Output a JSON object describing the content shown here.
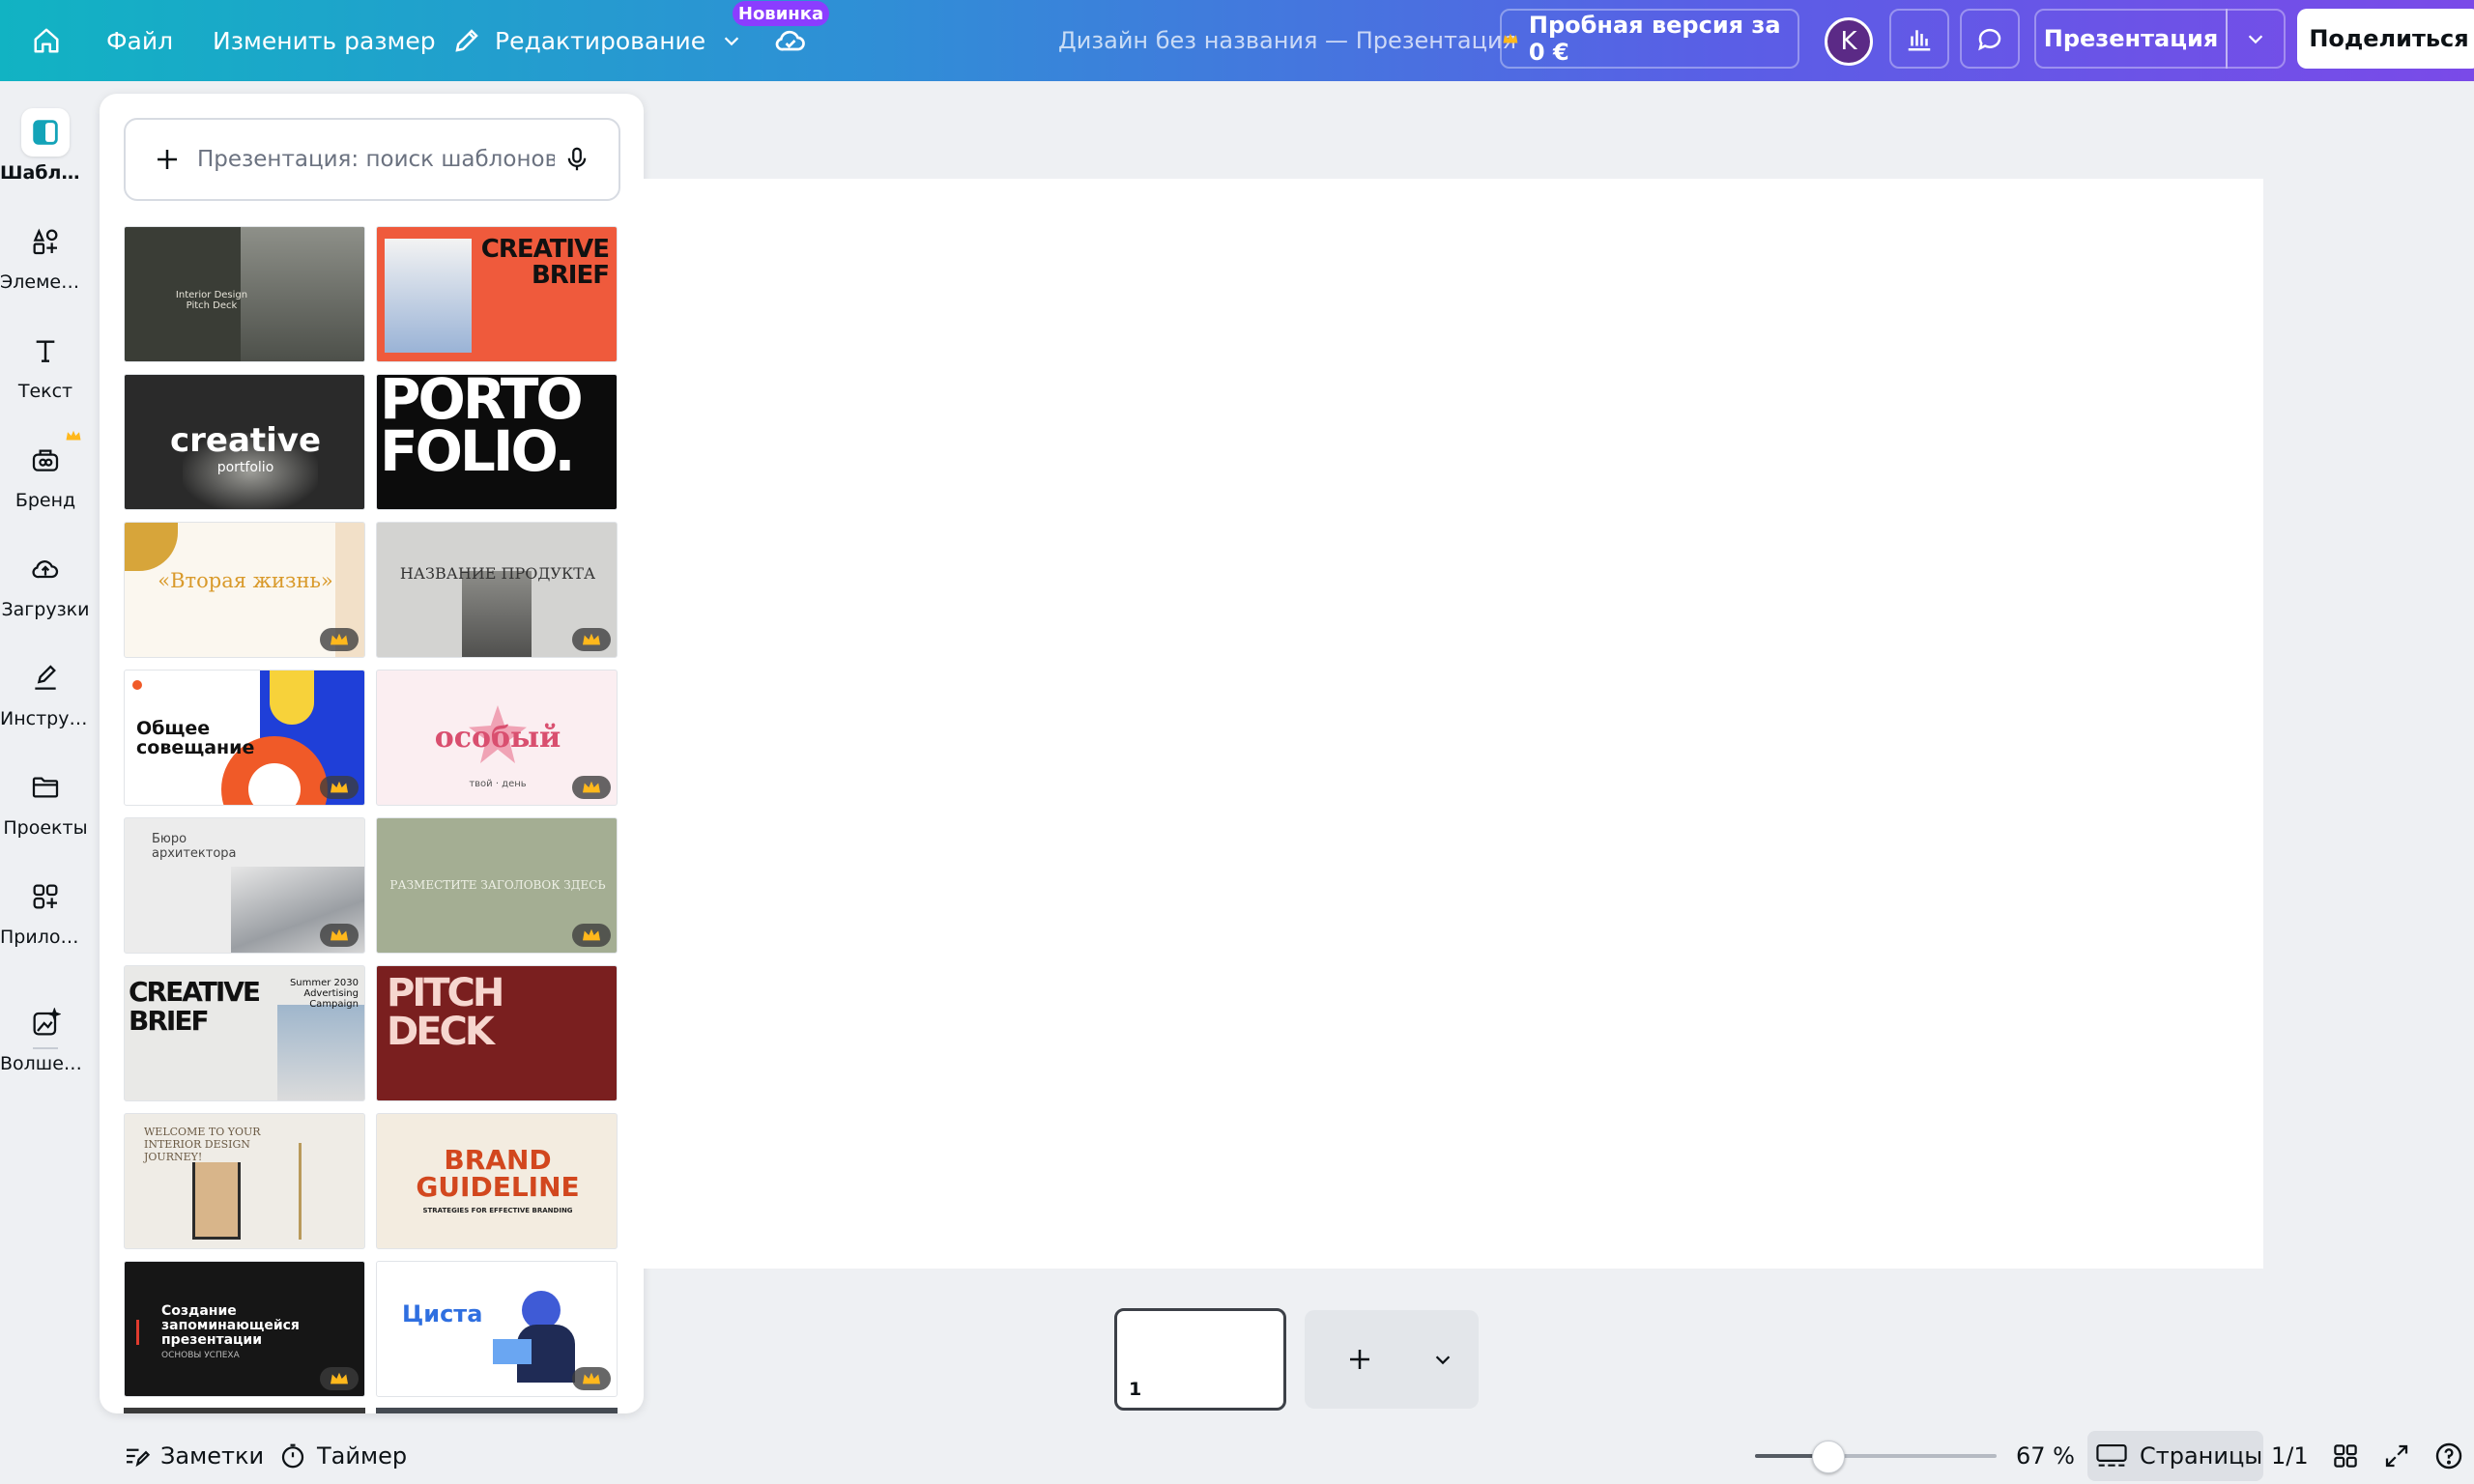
{
  "topbar": {
    "file_label": "Файл",
    "resize_label": "Изменить размер",
    "edit_label": "Редактирование",
    "new_badge": "Новинка",
    "title": "Дизайн без названия — Презентация",
    "trial_label": "Пробная версия за 0 €",
    "avatar_letter": "K",
    "present_label": "Презентация",
    "share_label": "Поделиться"
  },
  "rail": {
    "items": [
      {
        "label": "Шаблоны",
        "icon": "templates-icon"
      },
      {
        "label": "Элементы",
        "icon": "elements-icon"
      },
      {
        "label": "Текст",
        "icon": "text-icon"
      },
      {
        "label": "Бренд",
        "icon": "brand-icon"
      },
      {
        "label": "Загрузки",
        "icon": "uploads-icon"
      },
      {
        "label": "Инструменты",
        "icon": "draw-icon"
      },
      {
        "label": "Проекты",
        "icon": "folder-icon"
      },
      {
        "label": "Приложения",
        "icon": "apps-icon"
      },
      {
        "label": "Волшебные",
        "icon": "magic-icon"
      }
    ]
  },
  "panel": {
    "search_placeholder": "Презентация: поиск шаблонов",
    "templates": [
      {
        "text": "Interior Design Pitch Deck",
        "bg": "#3a3d36",
        "fg": "#e8e5da",
        "premium": false
      },
      {
        "text": "CREATIVE BRIEF",
        "bg": "#ef5a3c",
        "fg": "#111111",
        "premium": false
      },
      {
        "text": "creative",
        "sub": "portfolio",
        "bg": "#2a2a2a",
        "fg": "#ffffff",
        "premium": false
      },
      {
        "text": "PORTO FOLIO.",
        "bg": "#0c0c0c",
        "fg": "#ffffff",
        "premium": false
      },
      {
        "text": "«Вторая жизнь»",
        "bg": "#fbf7ef",
        "fg": "#d99a2b",
        "premium": true
      },
      {
        "text": "НАЗВАНИЕ ПРОДУКТА",
        "bg": "#d3d3d1",
        "fg": "#333333",
        "premium": true
      },
      {
        "text": "Общее совещание",
        "bg": "#ffffff",
        "fg": "#111111",
        "premium": true
      },
      {
        "text": "особый",
        "sub": "твой · день",
        "bg": "#fbeef1",
        "fg": "#d94f6f",
        "premium": true
      },
      {
        "text": "Бюро архитектора",
        "bg": "#ececec",
        "fg": "#444444",
        "premium": true
      },
      {
        "text": "РАЗМЕСТИТЕ ЗАГОЛОВОК ЗДЕСЬ",
        "bg": "#a4ae93",
        "fg": "#eef0e6",
        "premium": true
      },
      {
        "text": "CREATIVE BRIEF",
        "sub": "Summer 2030 Advertising Campaign",
        "bg": "#e9e9e7",
        "fg": "#111111",
        "premium": false
      },
      {
        "text": "PITCH DECK",
        "bg": "#7a1f1f",
        "fg": "#f6d6cf",
        "premium": false
      },
      {
        "text": "WELCOME TO YOUR INTERIOR DESIGN JOURNEY!",
        "bg": "#efece6",
        "fg": "#6b5a44",
        "premium": false
      },
      {
        "text": "BRAND GUIDELINE",
        "sub": "STRATEGIES FOR EFFECTIVE BRANDING",
        "bg": "#f3ece0",
        "fg": "#d2471e",
        "premium": false
      },
      {
        "text": "Создание запоминающейся презентации",
        "sub": "ОСНОВЫ УСПЕХА",
        "bg": "#161616",
        "fg": "#ffffff",
        "premium": true
      },
      {
        "text": "Циста",
        "bg": "#ffffff",
        "fg": "#2f6fe0",
        "premium": true
      }
    ]
  },
  "canvas": {
    "page_number": "1"
  },
  "bottombar": {
    "notes_label": "Заметки",
    "timer_label": "Таймер",
    "zoom_fraction": 0.3,
    "zoom_label": "67 %",
    "pages_label": "Страницы",
    "page_count": "1/1"
  }
}
